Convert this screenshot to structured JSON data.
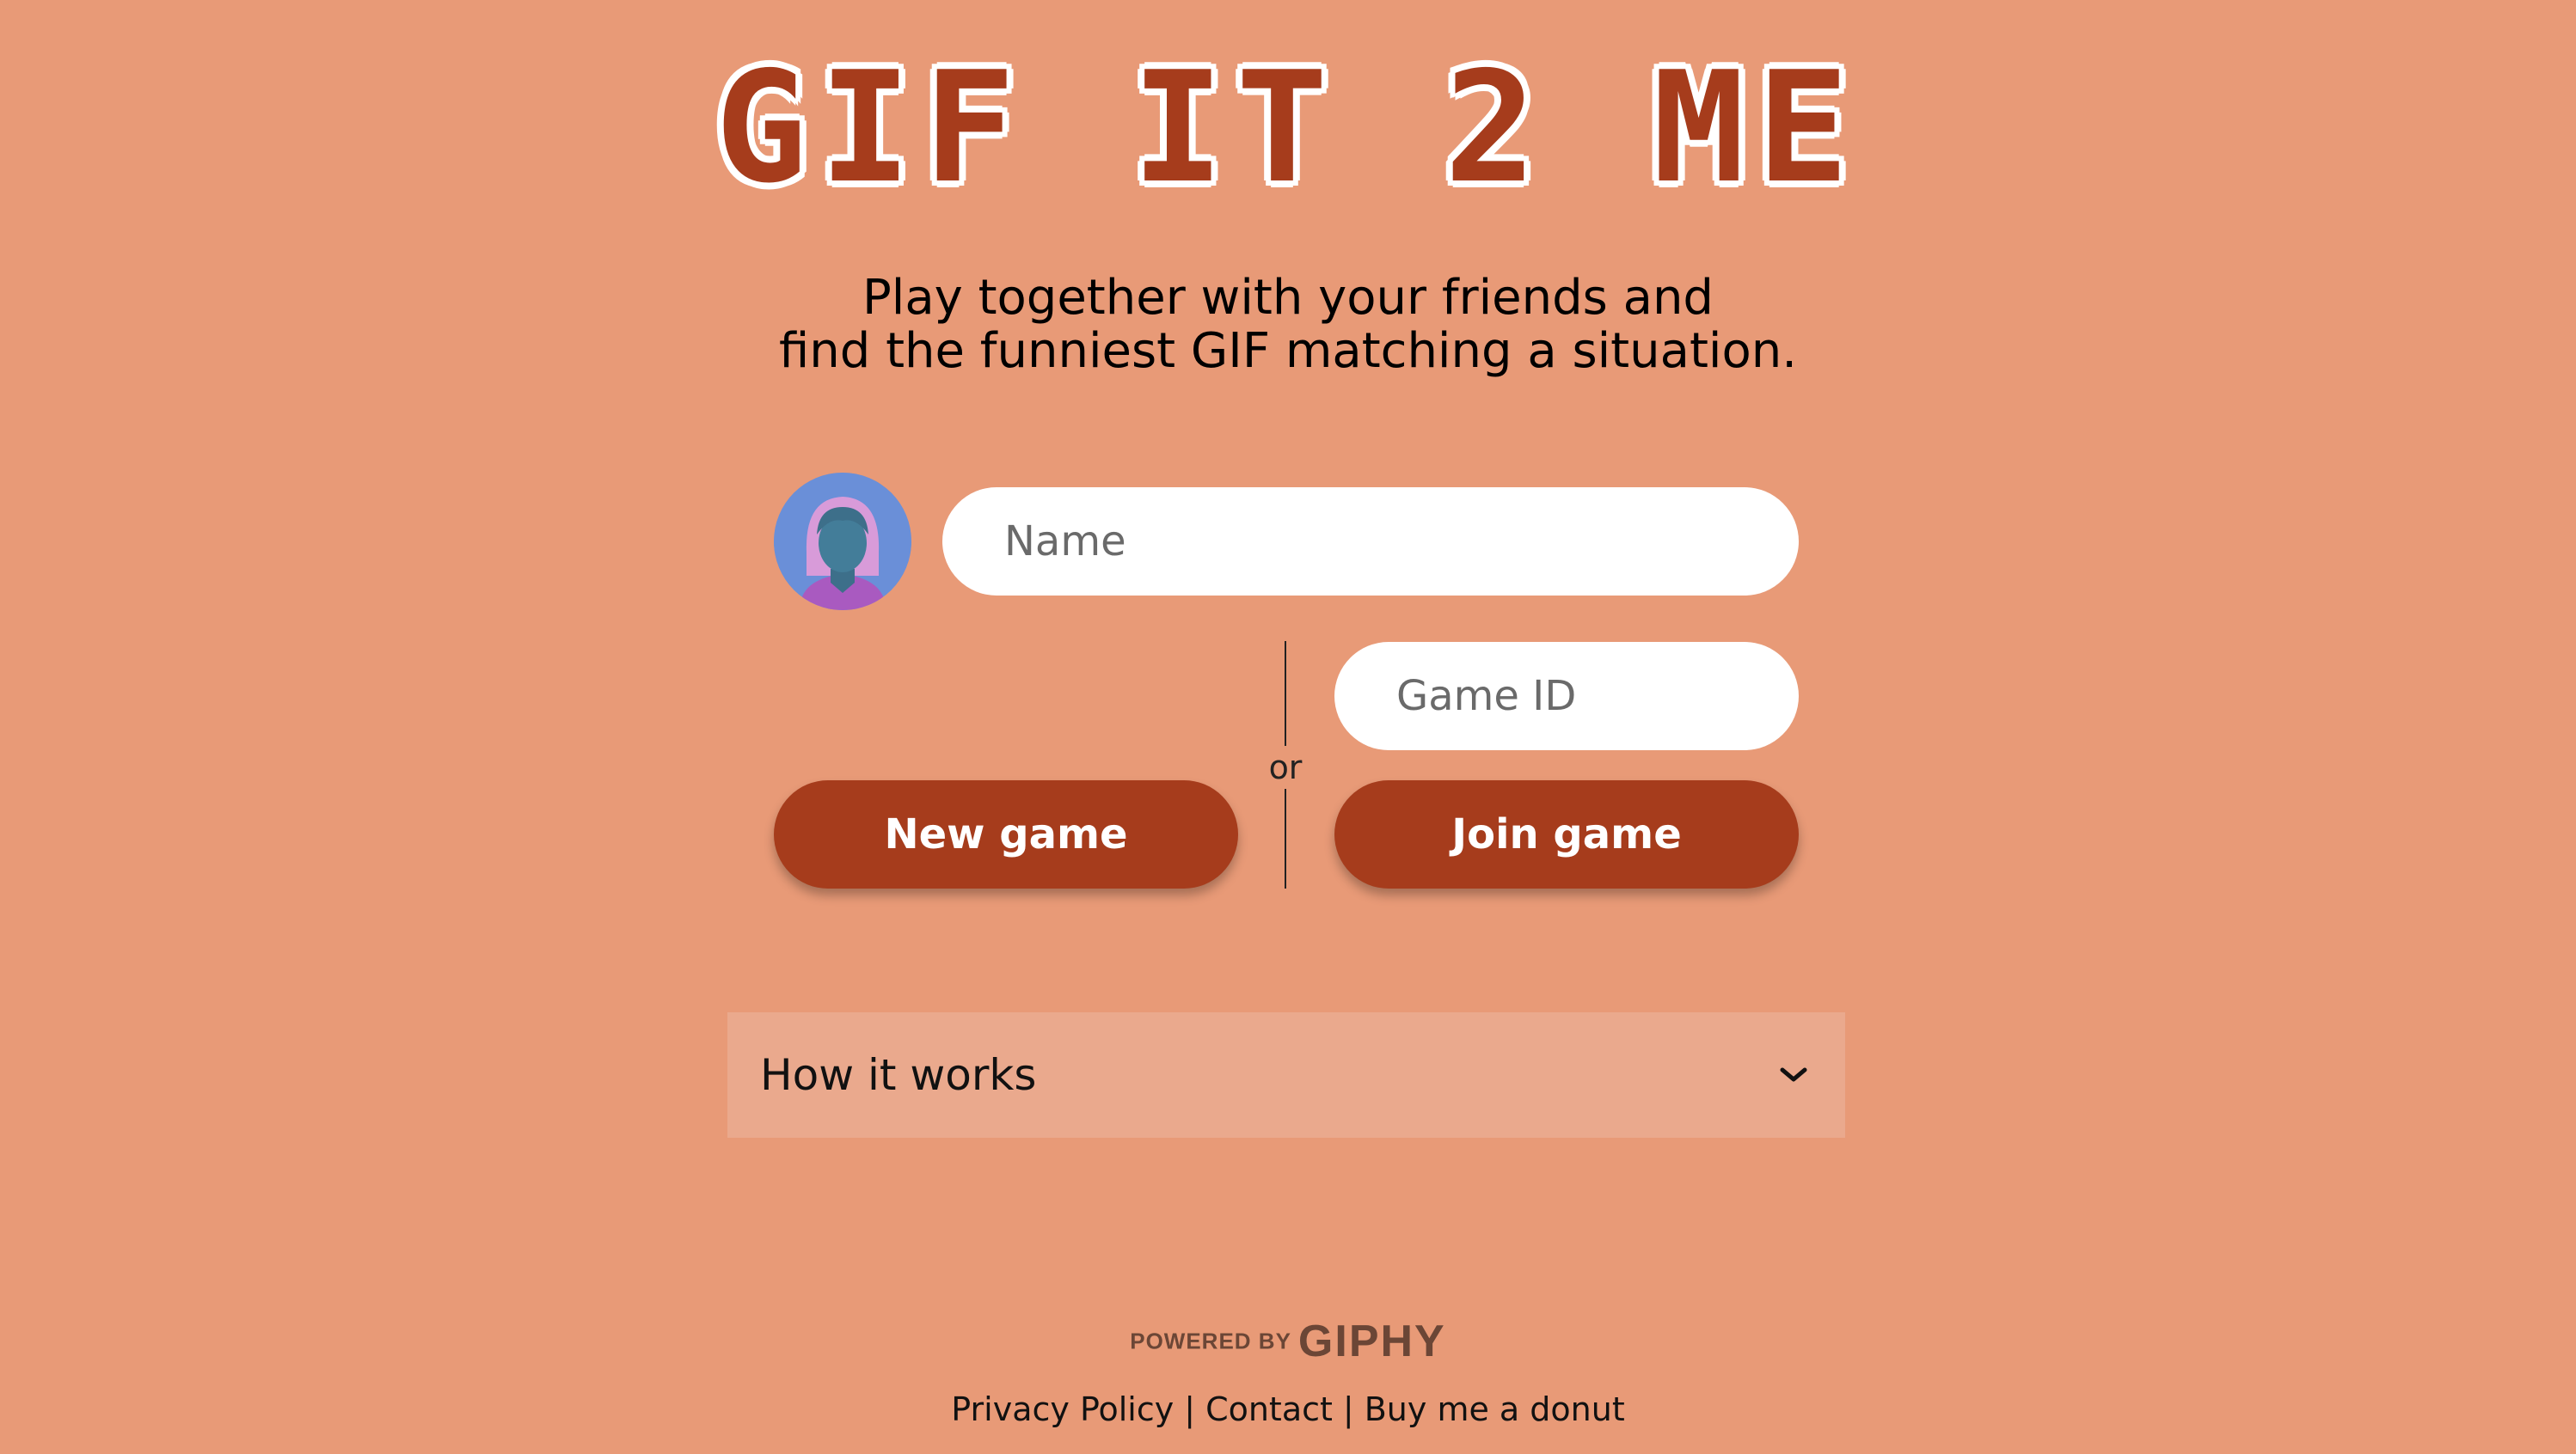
{
  "header": {
    "logo_text": "GIF IT 2 ME"
  },
  "tagline": {
    "line1": "Play together with your friends and",
    "line2": "find the funniest GIF matching a situation."
  },
  "form": {
    "name_placeholder": "Name",
    "game_id_placeholder": "Game ID",
    "or_label": "or",
    "new_game_label": "New game",
    "join_game_label": "Join game"
  },
  "accordion": {
    "label": "How it works",
    "icon": "chevron-down-icon"
  },
  "powered": {
    "prefix": "POWERED BY",
    "brand": "GIPHY"
  },
  "footer": {
    "links": [
      {
        "label": "Privacy Policy"
      },
      {
        "label": "Contact"
      },
      {
        "label": "Buy me a donut"
      }
    ],
    "separator": "|"
  },
  "colors": {
    "background": "#e89a77",
    "accent": "#a63c1c",
    "accordion_bg": "#eaa98d"
  },
  "icons": {
    "avatar": "avatar-icon"
  }
}
